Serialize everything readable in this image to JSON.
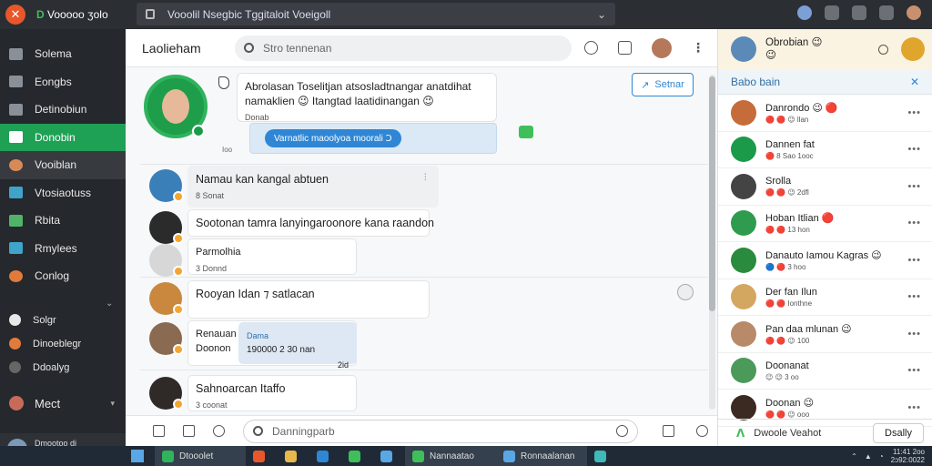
{
  "browser": {
    "brand_initial": "✕",
    "brand_d": "D",
    "brand_rest": "Vooooo ʒolo",
    "url": "Vooolil Nsegbic Tggitaloit Voeigoll",
    "url_chevron": "⌄"
  },
  "sidebar": {
    "items": [
      {
        "label": "Solema",
        "icon": "grid-icon"
      },
      {
        "label": "Eongbs",
        "icon": "inbox-icon"
      },
      {
        "label": "Detinobiun",
        "icon": "archive-icon"
      },
      {
        "label": "Donobin",
        "icon": "chat-icon",
        "active": true
      },
      {
        "label": "Vooiblan",
        "icon": "avatar-icon",
        "hover": true
      },
      {
        "label": "Vtosiaotuss",
        "icon": "wave-icon"
      },
      {
        "label": "Rbita",
        "icon": "chart-icon"
      },
      {
        "label": "Rmylees",
        "icon": "globe-icon"
      },
      {
        "label": "Conlog",
        "icon": "people-icon"
      }
    ],
    "collapse": "⌄",
    "sub_items": [
      {
        "label": "Solgr",
        "icon": "user-icon"
      },
      {
        "label": "Dinoeblegr",
        "icon": "flame-icon"
      },
      {
        "label": "Ddoalyg",
        "icon": "clock-icon"
      }
    ],
    "mect": {
      "label": "Mect",
      "chevron": "▾"
    },
    "user": {
      "line1": "Dmootoo di",
      "line2": "mnteritas"
    }
  },
  "main": {
    "title": "Laolieham",
    "search_placeholder": "Stro tennenan",
    "send_button": "Setnar",
    "send_icon": "↗",
    "featured": {
      "line1": "Abrolasan Toselitjan atsosladtnangar anatdihat",
      "line2": "namaklien 😉 Itangtad laatidinangan 😉",
      "meta": "Donab",
      "action": "Varnatlic maoolyoa moorali Ↄ",
      "time": "Ioo"
    },
    "messages": [
      {
        "text": "Namau kan kangal abtuen",
        "meta": "8 Sonat",
        "kebab": "⫶"
      },
      {
        "text": "Sootonan tamra lanyingaroonore kana raandon",
        "meta": ""
      },
      {
        "text": "Parmolhia",
        "meta": "3 Donnd"
      },
      {
        "text": "Rooyan Idan ⁊ satlacan",
        "meta": ""
      },
      {
        "text": "Renauan",
        "meta": "Doonon",
        "side_label": "Dama",
        "side_value": "190000 2 30 nan",
        "side_meta": "2id"
      },
      {
        "text": "Sahnoarcan Itaffo",
        "meta": "3 coonat"
      }
    ],
    "composer_placeholder": "Danningparb"
  },
  "right_panel": {
    "header_name": "Obrobian 😉",
    "header_sub": "😉",
    "subheader": "Babo bain",
    "close": "✕",
    "contacts": [
      {
        "name": "Danrondo 😉 🔴",
        "status": "🔴 🔴 😉 llan",
        "color": "#c66c3a"
      },
      {
        "name": "Dannen fat",
        "status": "🔴 8 Sao 1ooc",
        "color": "#1b9a49"
      },
      {
        "name": "Srolla",
        "status": "🔴 🔴 😉 2dfl",
        "color": "#444"
      },
      {
        "name": "Hoban Itlian 🔴",
        "status": "🔴 🔴 13 hon",
        "color": "#2e9b4e"
      },
      {
        "name": "Danauto Iamou Kagras 😉",
        "status": "🔵 🔴 3 hoo",
        "color": "#2a8a3e"
      },
      {
        "name": "Der fan Ilun",
        "status": "🔴 🔴 Ionthne",
        "color": "#d4a760"
      },
      {
        "name": "Pan daa mlunan 😉",
        "status": "🔴 🔴 😉 100",
        "color": "#b88a6a"
      },
      {
        "name": "Doonanat",
        "status": "😉 😉 3 oo",
        "color": "#4b9a5a"
      },
      {
        "name": "Doonan 😉",
        "status": "🔴 🔴 😉 ooo",
        "color": "#3a2a22"
      }
    ],
    "dots": "•••",
    "footer_label": "Dwoole Veahot",
    "footer_button": "Dsally",
    "footer_logo": "ᐱ"
  },
  "taskbar": {
    "items": [
      {
        "label": "Dtooolet",
        "color": "#2fb35c",
        "wide": true
      },
      {
        "label": "",
        "color": "#e8572c"
      },
      {
        "label": "",
        "color": "#e8b84b"
      },
      {
        "label": "",
        "color": "#2f86d4"
      },
      {
        "label": "",
        "color": "#3fbf5a"
      },
      {
        "label": "",
        "color": "#5aa7e6"
      },
      {
        "label": "Nannaatao",
        "color": "#3fbf5a",
        "wide": true
      },
      {
        "label": "Ronnaalanan",
        "color": "#5aa7e6",
        "wide": true
      },
      {
        "label": "",
        "color": "#3fb8b8"
      }
    ],
    "clock_line1": "11:41 2oo",
    "clock_line2": "2ɔ92:0022"
  }
}
